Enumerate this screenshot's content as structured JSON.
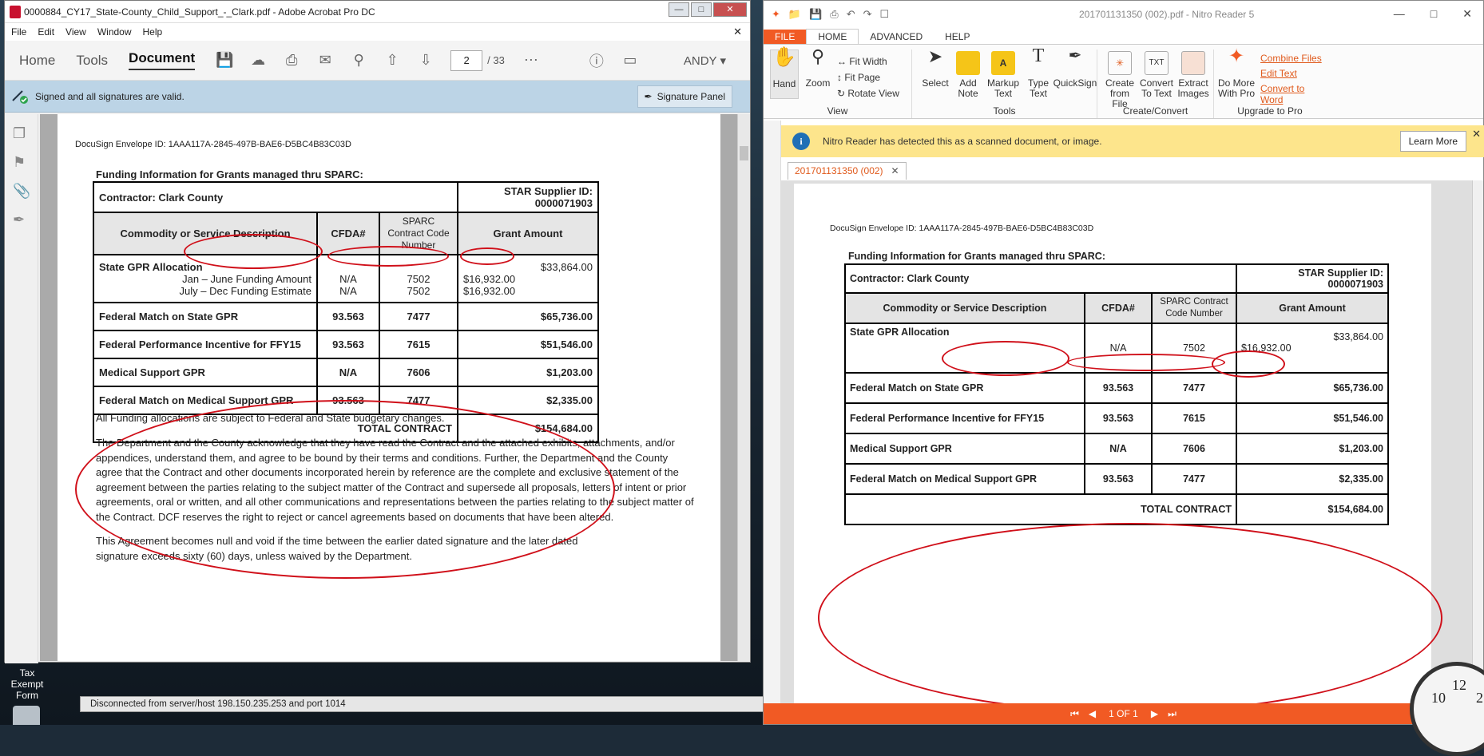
{
  "acrobat": {
    "title": "0000884_CY17_State-County_Child_Support_-_Clark.pdf - Adobe Acrobat Pro DC",
    "menu": [
      "File",
      "Edit",
      "View",
      "Window",
      "Help"
    ],
    "tabs": [
      "Home",
      "Tools",
      "Document"
    ],
    "page_current": "2",
    "page_total": "/ 33",
    "user": "ANDY",
    "sig_message": "Signed and all signatures are valid.",
    "sig_panel": "Signature Panel"
  },
  "doc": {
    "envelope": "DocuSign Envelope ID: 1AAA117A-2845-497B-BAE6-D5BC4B83C03D",
    "funding_title": "Funding Information for Grants managed thru SPARC:",
    "contractor": "Contractor:  Clark County",
    "supplier": "STAR Supplier ID:  0000071903",
    "headers": [
      "Commodity or Service Description",
      "CFDA#",
      "SPARC Contract Code Number",
      "Grant Amount"
    ],
    "gpr": {
      "label": "State GPR Allocation",
      "total": "$33,864.00",
      "jan_label": "Jan – June Funding Amount",
      "jul_label": "July – Dec Funding Estimate",
      "cfda": "N/A",
      "code": "7502",
      "amount": "$16,932.00"
    },
    "rows": [
      {
        "desc": "Federal Match on State GPR",
        "cfda": "93.563",
        "code": "7477",
        "amount": "$65,736.00"
      },
      {
        "desc": "Federal Performance Incentive for FFY15",
        "cfda": "93.563",
        "code": "7615",
        "amount": "$51,546.00"
      },
      {
        "desc": "Medical Support GPR",
        "cfda": "N/A",
        "code": "7606",
        "amount": "$1,203.00"
      },
      {
        "desc": "Federal Match on Medical Support GPR",
        "cfda": "93.563",
        "code": "7477",
        "amount": "$2,335.00"
      }
    ],
    "total_label": "TOTAL CONTRACT",
    "total_amount": "$154,684.00",
    "para1": "All Funding allocations are subject to Federal and State budgetary changes.",
    "para2": "The Department and the County acknowledge that they have read the Contract and the attached exhibits, attachments, and/or appendices, understand them, and agree to be bound by their terms and conditions.  Further, the Department and the County agree that the Contract and other documents incorporated herein by reference are the complete and exclusive statement of the agreement between the parties relating to the subject matter of the Contract and supersede all proposals, letters of intent or prior agreements, oral or written, and all other communications and representations between the parties relating to the subject matter of the Contract.  DCF reserves the right to reject or cancel agreements based on documents that have been altered.",
    "para3": "This Agreement becomes null and void if the time between the earlier dated signature and the later dated signature exceeds sixty (60) days, unless waived by the Department."
  },
  "desktop": {
    "status_text": "Disconnected from server/host 198.150.235.253 and port 1014",
    "icon_label": "Tax Exempt Form"
  },
  "nitro": {
    "title": "201701131350 (002).pdf - Nitro Reader 5",
    "tabs": [
      "FILE",
      "HOME",
      "ADVANCED",
      "HELP"
    ],
    "hand": "Hand",
    "zoom": "Zoom",
    "fit_width": "Fit Width",
    "fit_page": "Fit Page",
    "rotate_view": "Rotate View",
    "group_view": "View",
    "select": "Select",
    "add_note": "Add Note",
    "markup_text": "Markup Text",
    "type_text": "Type Text",
    "quicksign": "QuickSign",
    "group_tools": "Tools",
    "create_from_file": "Create from File",
    "convert_to_text": "Convert To Text",
    "extract_images": "Extract Images",
    "group_create": "Create/Convert",
    "do_more": "Do More With Pro",
    "combine_files": "Combine Files",
    "edit_text": "Edit Text",
    "convert_word": "Convert to Word",
    "group_upgrade": "Upgrade to Pro",
    "notice": "Nitro Reader has detected this as a scanned document, or image.",
    "learn_more": "Learn More",
    "doc_tab": "201701131350 (002)",
    "page_indicator": "1 OF 1"
  },
  "colors": {
    "annotation_red": "#d0101a",
    "nitro_orange": "#f15a24",
    "acrobat_sigbar": "#bcd4e6",
    "notice_yellow": "#fde58c"
  }
}
